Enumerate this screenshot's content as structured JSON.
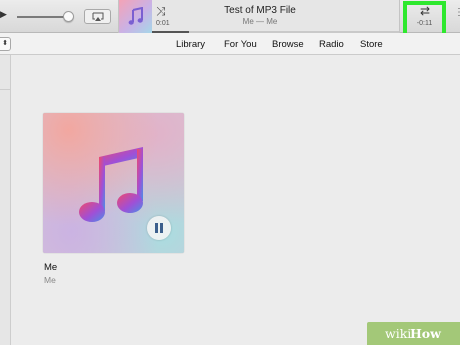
{
  "player": {
    "play_glyph": "▶",
    "volume_level": 0.9,
    "now_playing": {
      "title": "Test of MP3 File",
      "subtitle": "Me — Me",
      "elapsed": "0:01",
      "remaining": "-0:11",
      "progress": 0.15
    },
    "shuffle_icon": "shuffle-icon",
    "repeat_icon": "repeat-icon",
    "more_glyph": "⋮"
  },
  "toolbar": {
    "stepper_glyph": "⬍",
    "tabs": [
      {
        "label": "Library",
        "active": true
      },
      {
        "label": "For You",
        "active": false
      },
      {
        "label": "Browse",
        "active": false
      },
      {
        "label": "Radio",
        "active": false
      },
      {
        "label": "Store",
        "active": false
      }
    ]
  },
  "album": {
    "title": "Me",
    "artist": "Me",
    "state": "playing",
    "art_icon": "music-note-icon",
    "overlay_icon": "pause-icon"
  },
  "watermark": {
    "wiki": "wiki",
    "how": "How"
  },
  "colors": {
    "accent": "#1a73d3",
    "highlight": "#2ee82e",
    "watermark": "#9cc46e",
    "background": "#ececec"
  }
}
